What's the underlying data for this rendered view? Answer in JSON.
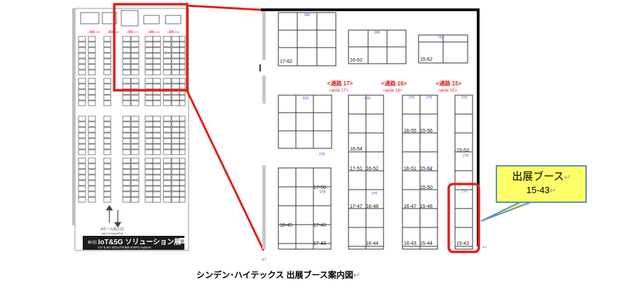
{
  "overview": {
    "top_label_small": "東4ホール",
    "entrance_label": "4ホール出入口",
    "entrance_sub": "Hall 4 Entrance/Exit",
    "banner_small": "第2回",
    "banner_title": "IoT&5G ソリューション展",
    "banner_badge": "秋",
    "banner_sub": "IoT & 5G SOLUTIONS EXPO Autumn"
  },
  "aisles": [
    {
      "label": "<通路 17>",
      "sub": "<aisle 17>"
    },
    {
      "label": "<通路 16>",
      "sub": "<aisle 16>"
    },
    {
      "label": "<通路 15>",
      "sub": "<aisle 15>"
    }
  ],
  "booths": {
    "top": [
      "17-62",
      "16-62",
      "15-62"
    ],
    "col1": [
      "17-50",
      "17-46",
      "18-45",
      "17-43"
    ],
    "col2": [
      "16-54",
      "17-51",
      "16-52",
      "17-47",
      "16-48",
      "16-44"
    ],
    "col3": [
      "16-55",
      "15-56",
      "16-51",
      "15-52",
      "15-50",
      "16-47",
      "15-48",
      "16-43",
      "15-44"
    ],
    "col4": [
      "15-53",
      "15-43"
    ]
  },
  "dims": {
    "d900": "900",
    "d810": "810",
    "d270": "270",
    "d720": "720",
    "d540": "540",
    "d450": "450",
    "d360": "360",
    "d180": "180",
    "d630": "630",
    "d990": "990",
    "d1080": "1080",
    "d1350": "1350",
    "d1620": "1620"
  },
  "callout": {
    "title": "出展ブース",
    "booth": "15-43",
    "return_mark": "↵"
  },
  "caption": {
    "text": "シンデン･ハイテックス 出展ブース案内図",
    "return_mark": "↵"
  },
  "colors": {
    "highlight": "#e0201c",
    "aisle_text": "#e0201c",
    "callout_fill": "#ffff66",
    "callout_border": "#5a8ec6",
    "dim_text": "#3355cc"
  }
}
